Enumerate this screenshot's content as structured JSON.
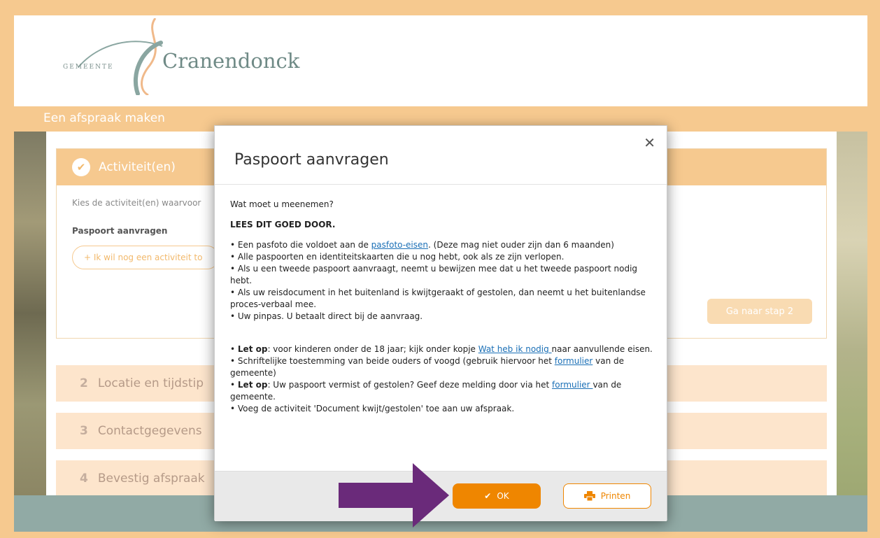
{
  "logo": {
    "prefix": "GEMEENTE",
    "name": "Cranendonck"
  },
  "page_title": "Een afspraak maken",
  "step1": {
    "title": "Activiteit(en)",
    "intro": "Kies de activiteit(en) waarvoor",
    "selected_activity": "Paspoort aanvragen",
    "add_button": "+ Ik wil nog een activiteit to",
    "next_button": "Ga naar stap 2"
  },
  "steps": [
    {
      "number": "2",
      "label": "Locatie en tijdstip"
    },
    {
      "number": "3",
      "label": "Contactgegevens"
    },
    {
      "number": "4",
      "label": "Bevestig afspraak"
    }
  ],
  "modal": {
    "close_label": "✕",
    "title": "Paspoort aanvragen",
    "intro": "Wat moet u meenemen?",
    "heading": "LEES DIT GOED DOOR.",
    "list1": {
      "b1_pre": "•  Een pasfoto die voldoet aan de ",
      "b1_link": "pasfoto-eisen",
      "b1_post": ". (Deze mag niet ouder zijn dan 6 maanden)",
      "b2": "•  Alle paspoorten en identiteitskaarten die u nog hebt, ook als ze zijn verlopen.",
      "b3": "•  Als u een tweede paspoort aanvraagt, neemt u bewijzen mee dat u het tweede paspoort nodig hebt.",
      "b4": "•  Als uw reisdocument in het buitenland is kwijtgeraakt of gestolen, dan neemt u het buitenlandse proces-verbaal mee.",
      "b5": "•  Uw pinpas. U betaalt direct bij de aanvraag."
    },
    "list2": {
      "b1_bullet": "•  ",
      "b1_bold": "Let op",
      "b1_mid": ": voor kinderen onder de 18 jaar; kijk onder kopje ",
      "b1_link": "Wat heb ik nodig ",
      "b1_post": "naar aanvullende eisen.",
      "b2_pre": "•  Schriftelijke toestemming van beide ouders of voogd (gebruik hiervoor het ",
      "b2_link": "formulier",
      "b2_post": " van de gemeente)",
      "b3_bullet": "•  ",
      "b3_bold": "Let op",
      "b3_mid": ": Uw paspoort vermist of gestolen? Geef deze melding door via het ",
      "b3_link": "formulier ",
      "b3_post": "van de gemeente.",
      "b4": "•  Voeg de activiteit 'Document kwijt/gestolen' toe aan uw afspraak."
    },
    "ok_label": "OK",
    "print_label": "Printen"
  },
  "colors": {
    "brand_peach": "#f6c98f",
    "ok_orange": "#ef8600",
    "arrow_purple": "#6a2a7a",
    "footer_teal": "#91aaa5"
  }
}
